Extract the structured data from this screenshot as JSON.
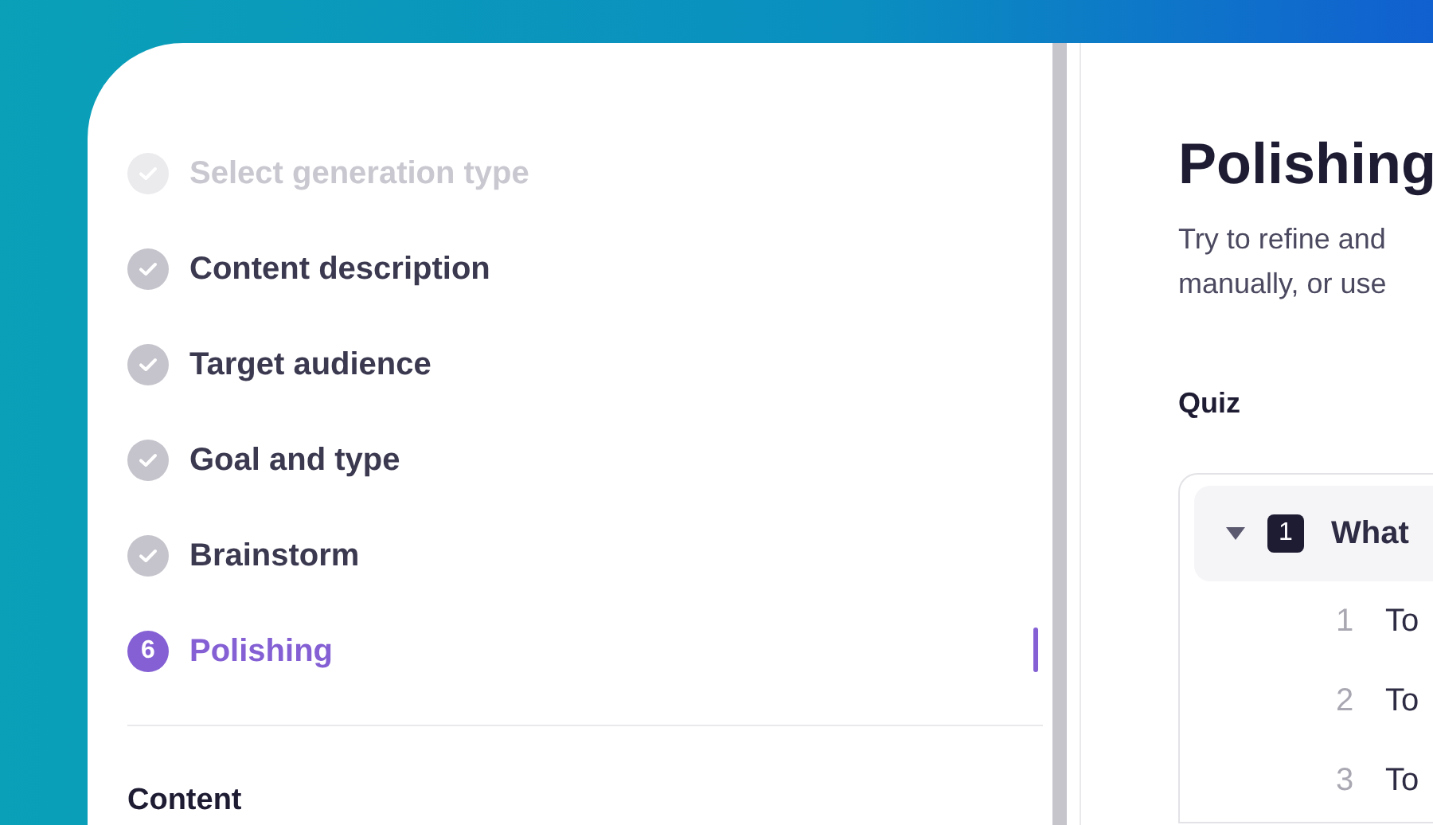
{
  "steps": [
    {
      "label": "Select generation type",
      "kind": "check",
      "dimmed": true,
      "selected": false
    },
    {
      "label": "Content description",
      "kind": "check",
      "dimmed": false,
      "selected": false
    },
    {
      "label": "Target audience",
      "kind": "check",
      "dimmed": false,
      "selected": false
    },
    {
      "label": "Goal and type",
      "kind": "check",
      "dimmed": false,
      "selected": false
    },
    {
      "label": "Brainstorm",
      "kind": "check",
      "dimmed": false,
      "selected": false
    },
    {
      "label": "Polishing",
      "kind": "number",
      "number": "6",
      "dimmed": false,
      "selected": true
    }
  ],
  "sidebar_section": "Content",
  "main": {
    "title": "Polishing",
    "description_lines": [
      "Try to refine and",
      "manually, or use"
    ],
    "section": "Quiz",
    "questions": [
      {
        "number": "1",
        "text": "What",
        "expanded": true,
        "answers": [
          {
            "number": "1",
            "text": "To"
          },
          {
            "number": "2",
            "text": "To"
          },
          {
            "number": "3",
            "text": "To"
          }
        ]
      }
    ]
  }
}
